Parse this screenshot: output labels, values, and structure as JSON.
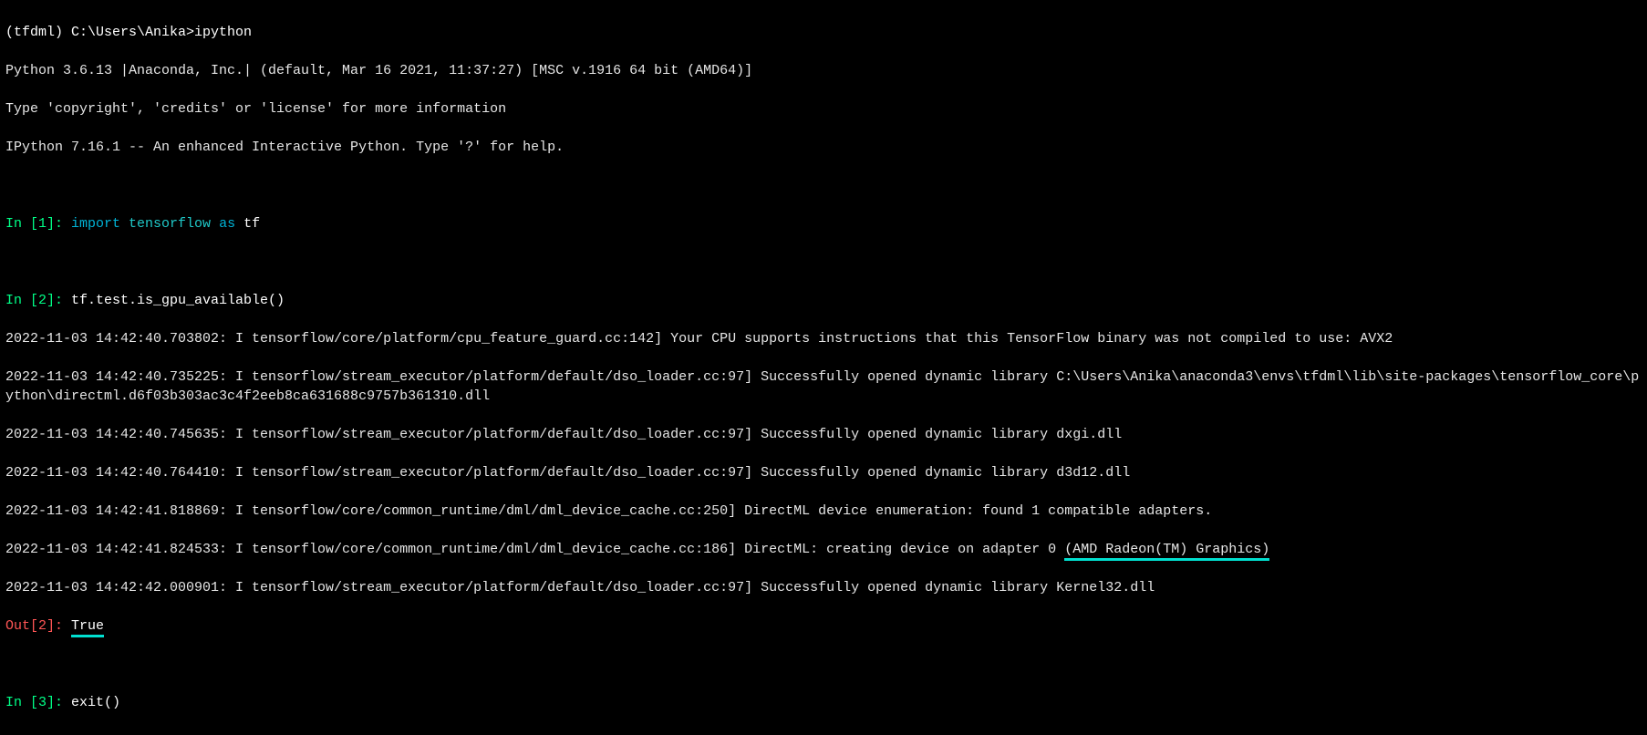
{
  "header": {
    "shell_prompt": "(tfdml) C:\\Users\\Anika>",
    "shell_cmd": "ipython",
    "python_line": "Python 3.6.13 |Anaconda, Inc.| (default, Mar 16 2021, 11:37:27) [MSC v.1916 64 bit (AMD64)]",
    "type_line": "Type 'copyright', 'credits' or 'license' for more information",
    "ipython_line": "IPython 7.16.1 -- An enhanced Interactive Python. Type '?' for help."
  },
  "in1": {
    "prompt": "In [1]: ",
    "kw_import": "import ",
    "module": "tensorflow ",
    "kw_as": "as ",
    "alias": "tf"
  },
  "in2": {
    "prompt": "In [2]: ",
    "code": "tf.test.is_gpu_available()"
  },
  "logs": {
    "l1": "2022-11-03 14:42:40.703802: I tensorflow/core/platform/cpu_feature_guard.cc:142] Your CPU supports instructions that this TensorFlow binary was not compiled to use: AVX2",
    "l2": "2022-11-03 14:42:40.735225: I tensorflow/stream_executor/platform/default/dso_loader.cc:97] Successfully opened dynamic library C:\\Users\\Anika\\anaconda3\\envs\\tfdml\\lib\\site-packages\\tensorflow_core\\python\\directml.d6f03b303ac3c4f2eeb8ca631688c9757b361310.dll",
    "l3": "2022-11-03 14:42:40.745635: I tensorflow/stream_executor/platform/default/dso_loader.cc:97] Successfully opened dynamic library dxgi.dll",
    "l4": "2022-11-03 14:42:40.764410: I tensorflow/stream_executor/platform/default/dso_loader.cc:97] Successfully opened dynamic library d3d12.dll",
    "l5": "2022-11-03 14:42:41.818869: I tensorflow/core/common_runtime/dml/dml_device_cache.cc:250] DirectML device enumeration: found 1 compatible adapters.",
    "l6a": "2022-11-03 14:42:41.824533: I tensorflow/core/common_runtime/dml/dml_device_cache.cc:186] DirectML: creating device on adapter 0 ",
    "l6b": "(AMD Radeon(TM) Graphics)",
    "l7": "2022-11-03 14:42:42.000901: I tensorflow/stream_executor/platform/default/dso_loader.cc:97] Successfully opened dynamic library Kernel32.dll"
  },
  "out2": {
    "prompt": "Out[2]: ",
    "value": "True"
  },
  "in3": {
    "prompt": "In [3]: ",
    "code": "exit()"
  }
}
